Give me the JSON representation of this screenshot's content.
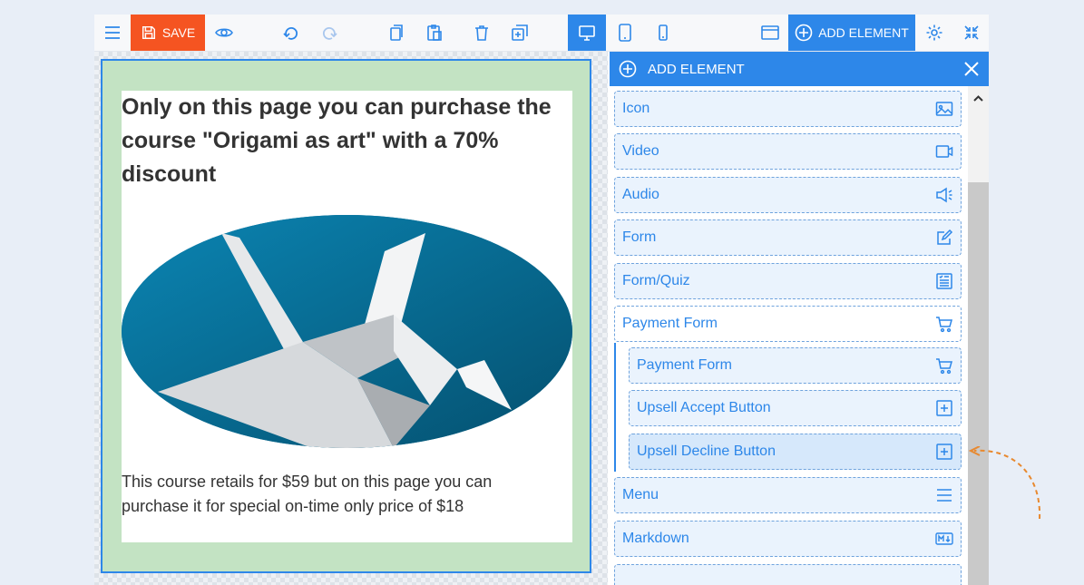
{
  "toolbar": {
    "save_label": "SAVE",
    "add_element_label": "ADD ELEMENT"
  },
  "canvas": {
    "headline": "Only on this page you can purchase the course \"Origami as art\" with a 70% discount",
    "body": "This course retails for $59 but on this page you can purchase it for special on-time only price of $18"
  },
  "panel": {
    "title": "ADD ELEMENT",
    "items": [
      {
        "label": "Icon",
        "icon": "image-icon"
      },
      {
        "label": "Video",
        "icon": "video-icon"
      },
      {
        "label": "Audio",
        "icon": "speaker-icon"
      },
      {
        "label": "Form",
        "icon": "edit-icon"
      },
      {
        "label": "Form/Quiz",
        "icon": "quiz-icon"
      },
      {
        "label": "Payment Form",
        "icon": "cart-icon"
      },
      {
        "label": "Payment Form",
        "icon": "cart-icon"
      },
      {
        "label": "Upsell Accept Button",
        "icon": "plus-square-icon"
      },
      {
        "label": "Upsell Decline Button",
        "icon": "plus-square-icon"
      },
      {
        "label": "Menu",
        "icon": "menu-icon"
      },
      {
        "label": "Markdown",
        "icon": "markdown-icon"
      }
    ]
  },
  "colors": {
    "accent": "#2d87e9",
    "save": "#f55421",
    "canvas_section": "#c3e3c3",
    "annotation_arrow": "#e8892f"
  }
}
